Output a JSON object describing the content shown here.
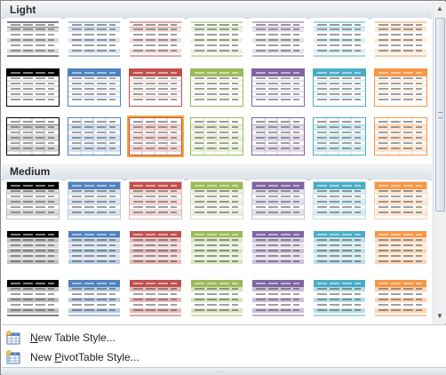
{
  "sections": [
    {
      "label": "Light"
    },
    {
      "label": "Medium"
    }
  ],
  "accent_colors": [
    "#000000",
    "#4f81bd",
    "#c0504d",
    "#9bbb59",
    "#8064a2",
    "#4bacc6",
    "#f79646"
  ],
  "light_colors": [
    "#d9d9d9",
    "#dbe5f1",
    "#f2dcdb",
    "#ebf1de",
    "#e5e0ec",
    "#daeef3",
    "#fde9d9"
  ],
  "mid_colors": [
    "#bfbfbf",
    "#b8cce4",
    "#e6b9b8",
    "#d7e4bc",
    "#ccc0da",
    "#b7dee8",
    "#fbd4b4"
  ],
  "selected_style": {
    "row": 3,
    "col": 3
  },
  "menu": {
    "new_table_style": {
      "prefix": "",
      "accel": "N",
      "suffix": "ew Table Style..."
    },
    "new_pivottable_style": {
      "prefix": "New ",
      "accel": "P",
      "suffix": "ivotTable Style..."
    }
  },
  "grip": "...."
}
